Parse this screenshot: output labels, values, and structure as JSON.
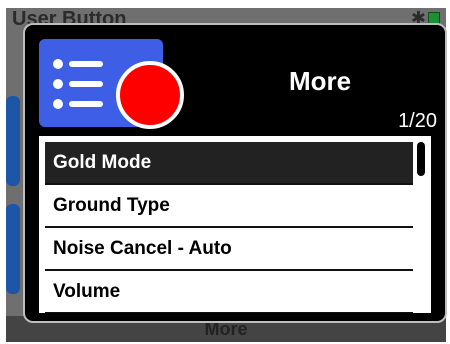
{
  "background": {
    "title": "User Button",
    "bottom_label": "More",
    "star": "✱"
  },
  "dialog": {
    "title": "More",
    "page_indicator": "1/20",
    "items": [
      {
        "label": "Gold Mode",
        "selected": true
      },
      {
        "label": "Ground Type",
        "selected": false
      },
      {
        "label": "Noise Cancel - Auto",
        "selected": false
      },
      {
        "label": "Volume",
        "selected": false
      }
    ]
  },
  "colors": {
    "dialog_background": "#000000",
    "tile_blue": "#3f5ee6",
    "indicator_red": "#ff0000",
    "selected_row": "#222222"
  },
  "icons": {
    "menu_tile": "list-icon",
    "indicator": "red-circle-icon"
  }
}
